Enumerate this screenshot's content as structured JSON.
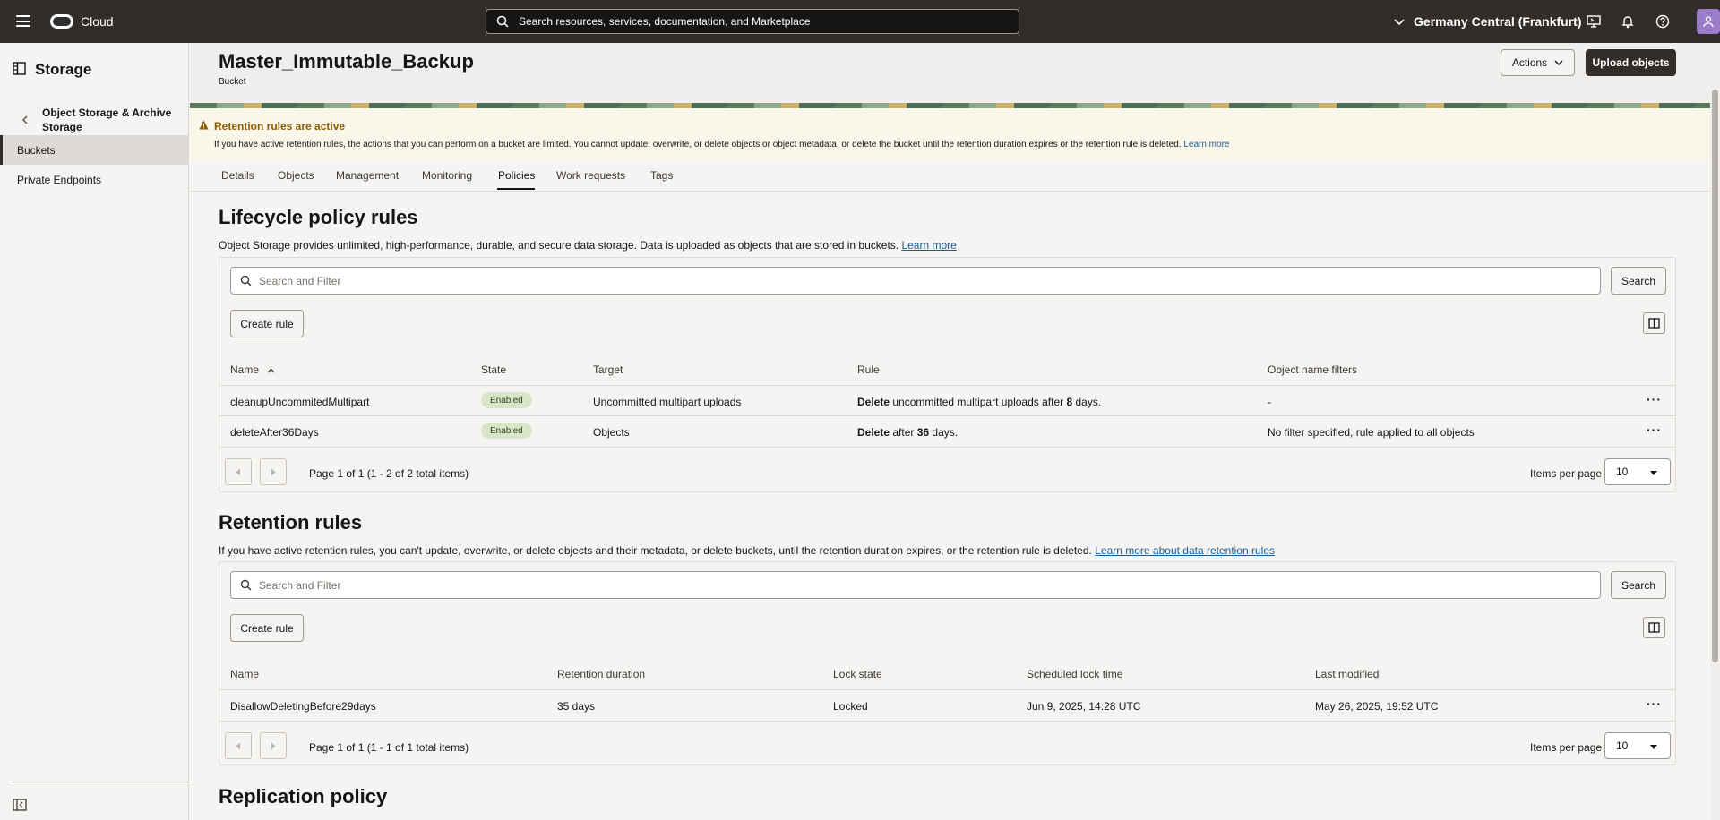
{
  "topbar": {
    "brand": "Cloud",
    "search_placeholder": "Search resources, services, documentation, and Marketplace",
    "region": "Germany Central (Frankfurt)"
  },
  "sidebar": {
    "title": "Storage",
    "parent": "Object Storage & Archive Storage",
    "items": [
      {
        "label": "Buckets",
        "active": true
      },
      {
        "label": "Private Endpoints",
        "active": false
      }
    ]
  },
  "header": {
    "title": "Master_Immutable_Backup",
    "subtitle": "Bucket",
    "actions_label": "Actions",
    "upload_label": "Upload objects"
  },
  "notice": {
    "title": "Retention rules are active",
    "text": "If you have active retention rules, the actions that you can perform on a bucket are limited. You cannot update, overwrite, or delete objects or object metadata, or delete the bucket until the retention duration expires or the retention rule is deleted.",
    "link": "Learn more"
  },
  "tabs": [
    "Details",
    "Objects",
    "Management",
    "Monitoring",
    "Policies",
    "Work requests",
    "Tags"
  ],
  "active_tab": "Policies",
  "lifecycle": {
    "title": "Lifecycle policy rules",
    "desc": "Object Storage provides unlimited, high-performance, durable, and secure data storage. Data is uploaded as objects that are stored in buckets.",
    "desc_link": "Learn more",
    "filter_placeholder": "Search and Filter",
    "search_label": "Search",
    "create_label": "Create rule",
    "columns": [
      "Name",
      "State",
      "Target",
      "Rule",
      "Object name filters"
    ],
    "rows": [
      {
        "name": "cleanupUncommitedMultipart",
        "state": "Enabled",
        "target": "Uncommitted multipart uploads",
        "rule_bold": "Delete",
        "rule_mid": " uncommitted multipart uploads after ",
        "rule_num": "8",
        "rule_end": " days.",
        "filter": "-"
      },
      {
        "name": "deleteAfter36Days",
        "state": "Enabled",
        "target": "Objects",
        "rule_bold": "Delete",
        "rule_mid": " after ",
        "rule_num": "36",
        "rule_end": " days.",
        "filter": "No filter specified, rule applied to all objects"
      }
    ],
    "pagination": "Page 1 of 1 (1 - 2 of 2 total items)",
    "ipp_label": "Items per page",
    "ipp_value": "10"
  },
  "retention": {
    "title": "Retention rules",
    "desc": "If you have active retention rules, you can't update, overwrite, or delete objects and their metadata, or delete buckets, until the retention duration expires, or the retention rule is deleted.",
    "desc_link": "Learn more about data retention rules",
    "filter_placeholder": "Search and Filter",
    "search_label": "Search",
    "create_label": "Create rule",
    "columns": [
      "Name",
      "Retention duration",
      "Lock state",
      "Scheduled lock time",
      "Last modified"
    ],
    "rows": [
      {
        "name": "DisallowDeletingBefore29days",
        "duration": "35 days",
        "lock": "Locked",
        "scheduled": "Jun 9, 2025, 14:28 UTC",
        "modified": "May 26, 2025, 19:52 UTC"
      }
    ],
    "pagination": "Page 1 of 1 (1 - 1 of 1 total items)",
    "ipp_label": "Items per page",
    "ipp_value": "10"
  },
  "replication": {
    "title": "Replication policy"
  }
}
